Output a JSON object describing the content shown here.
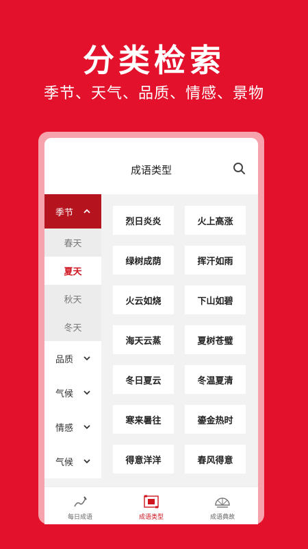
{
  "hero": {
    "title": "分类检索",
    "subtitle": "季节、天气、品质、情感、景物"
  },
  "screen": {
    "title": "成语类型",
    "search_icon": "search-icon"
  },
  "sidebar": {
    "expanded": {
      "label": "季节",
      "icon": "chevron-up-icon"
    },
    "subitems": [
      "春天",
      "夏天",
      "秋天",
      "冬天"
    ],
    "active_subitem": "夏天",
    "collapsed": [
      {
        "label": "品质",
        "icon": "chevron-down-icon"
      },
      {
        "label": "气候",
        "icon": "chevron-down-icon"
      },
      {
        "label": "情感",
        "icon": "chevron-down-icon"
      },
      {
        "label": "气候",
        "icon": "chevron-down-icon"
      }
    ]
  },
  "idioms": [
    "烈日炎炎",
    "火上高涨",
    "绿树成荫",
    "挥汗如雨",
    "火云如烧",
    "下山如碧",
    "海天云蒸",
    "夏树苍璧",
    "冬日夏云",
    "冬温夏清",
    "寒来暑往",
    "鎏金热时",
    "得意洋洋",
    "春风得意"
  ],
  "tabs": [
    {
      "label": "每日成语",
      "icon": "brush-icon",
      "active": false
    },
    {
      "label": "成语类型",
      "icon": "scroll-icon",
      "active": true
    },
    {
      "label": "成语典故",
      "icon": "fan-icon",
      "active": false
    }
  ],
  "colors": {
    "background": "#e3112b",
    "accent": "#d0141f",
    "sidebar_active": "#b5141e"
  }
}
